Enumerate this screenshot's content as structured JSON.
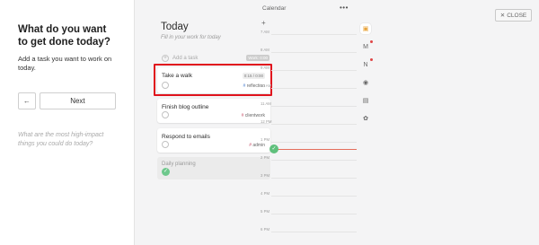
{
  "onboarding": {
    "heading": "What do you want to get done today?",
    "description": "Add a task you want to work on today.",
    "back_icon": "←",
    "next_label": "Next",
    "hint": "What are the most high-impact things you could do today?"
  },
  "today": {
    "title": "Today",
    "subtitle": "Fill in your work for today",
    "add_task": {
      "plus": "+",
      "placeholder": "Add a task",
      "badge": "Work: 0:00"
    },
    "tasks": [
      {
        "title": "Take a walk",
        "time": "0:15 / 0:00",
        "tag": "reflection",
        "highlighted": true
      },
      {
        "title": "Finish blog outline",
        "tag": "clientwork"
      },
      {
        "title": "Respond to emails",
        "tag": "admin"
      }
    ],
    "completed_task": {
      "title": "Daily planning",
      "check": "✓"
    }
  },
  "calendar": {
    "title": "Calendar",
    "more": "•••",
    "add": "+",
    "hours": [
      "7 AM",
      "8 AM",
      "9 AM",
      "10 AM",
      "11 AM",
      "12 PM",
      "1 PM",
      "2 PM",
      "3 PM",
      "4 PM",
      "5 PM",
      "6 PM",
      "7 PM"
    ],
    "now_check": "✓"
  },
  "rail": {
    "icons": [
      "calendar-app-icon",
      "gmail-icon",
      "notion-icon",
      "asana-icon",
      "archive-icon",
      "slack-icon"
    ],
    "glyphs": [
      "▣",
      "M",
      "N",
      "◉",
      "▤",
      "✿"
    ]
  },
  "close": {
    "label": "CLOSE",
    "icon": "✕"
  },
  "colors": {
    "highlight": "#e0131d",
    "now_line": "#e46d5b",
    "done_green": "#6ec88c",
    "tag_hash": "#c9566e"
  }
}
